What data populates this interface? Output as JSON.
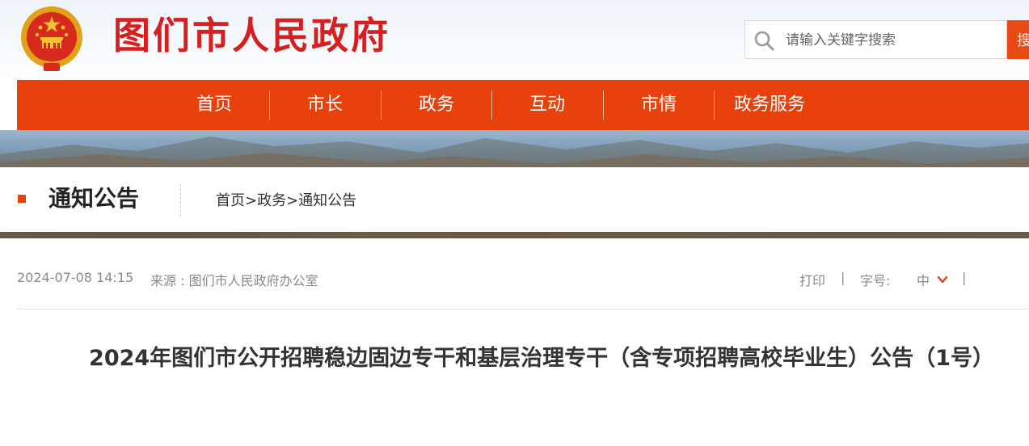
{
  "header": {
    "site_title": "图们市人民政府",
    "emblem": "national-emblem",
    "search": {
      "placeholder": "请输入关键字搜索",
      "button_label": "搜索"
    }
  },
  "nav": {
    "items": [
      {
        "label": "首页"
      },
      {
        "label": "市长"
      },
      {
        "label": "政务"
      },
      {
        "label": "互动"
      },
      {
        "label": "市情"
      },
      {
        "label": "政务服务"
      }
    ]
  },
  "section": {
    "title": "通知公告",
    "breadcrumb": [
      "首页",
      "政务",
      "通知公告"
    ],
    "breadcrumb_separator": ">"
  },
  "article": {
    "date": "2024-07-08 14:15",
    "source": "来源 : 图们市人民政府办公室",
    "tools": {
      "print_label": "打印",
      "separator": "|",
      "font_size_label": "字号:",
      "font_size_value": "中"
    },
    "title": "2024年图们市公开招聘稳边固边专干和基层治理专干（含专项招聘高校毕业生）公告（1号）"
  },
  "colors": {
    "accent": "#e8410c",
    "title_red": "#d61f1f",
    "meta_gray": "#8a8a8a"
  },
  "icons": {
    "search": "search-icon",
    "dropdown": "chevron-down-icon",
    "emblem": "national-emblem-icon"
  }
}
